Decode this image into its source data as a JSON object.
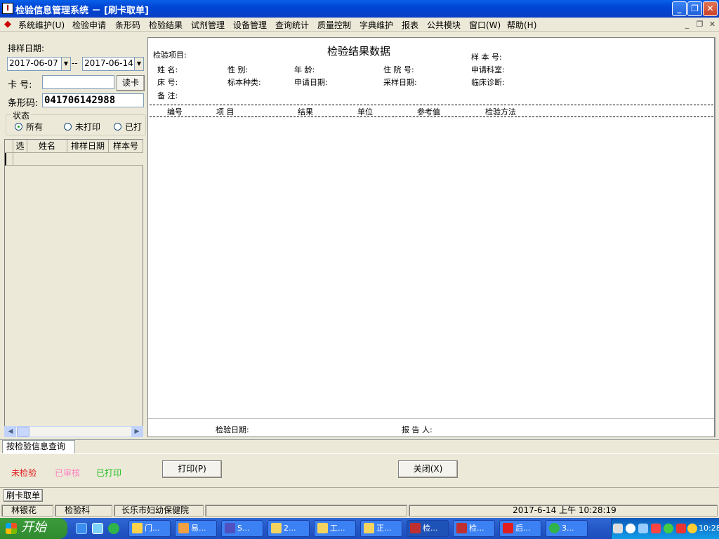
{
  "window": {
    "title": "检验信息管理系统 － [刷卡取单]",
    "controls": {
      "minimize": "_",
      "restore": "❐",
      "close": "✕"
    }
  },
  "menu": [
    "系统维护(U)",
    "检验申请",
    "条形码",
    "检验结果",
    "试剂管理",
    "设备管理",
    "查询统计",
    "质量控制",
    "字典维护",
    "报表",
    "公共模块",
    "窗口(W)",
    "帮助(H)"
  ],
  "left": {
    "date_label": "排样日期:",
    "date_from": "2017-06-07",
    "date_sep": "--",
    "date_to": "2017-06-14",
    "card_label": "卡  号:",
    "card_value": "",
    "read_card_button": "读卡",
    "barcode_label": "条形码:",
    "barcode_value": "041706142988",
    "status_group": "状态",
    "status_options": [
      "所有",
      "未打印",
      "已打"
    ],
    "grid_headers": [
      "选",
      "姓名",
      "排样日期",
      "样本号"
    ]
  },
  "report": {
    "title": "检验结果数据",
    "fields": {
      "item": "检验项目:",
      "sample_no": "样 本 号:",
      "name": "姓    名:",
      "gender": "性    别:",
      "age": "年    龄:",
      "inpatient_no": "住 院 号:",
      "dept": "申请科室:",
      "bed": "床    号:",
      "specimen": "标本种类:",
      "apply_date": "申请日期:",
      "collect_date": "采样日期:",
      "diagnosis": "临床诊断:",
      "remark": "备    注:"
    },
    "columns": [
      "编号",
      "项    目",
      "结果",
      "单位",
      "参考值",
      "检验方法"
    ],
    "footer": {
      "test_date": "检验日期:",
      "reporter": "报 告 人:"
    }
  },
  "bottom": {
    "tab_label": "按检验信息查询",
    "legend": [
      {
        "text": "未检验",
        "color": "#e02020"
      },
      {
        "text": "已审核",
        "color": "#ff80c0"
      },
      {
        "text": "已打印",
        "color": "#20c020"
      }
    ],
    "print_button": "打印(P)",
    "close_button": "关闭(X)",
    "form_tab": "刷卡取单"
  },
  "statusbar": [
    "林银花",
    "检验科",
    "长乐市妇幼保健院",
    "",
    "2017-6-14 上午 10:28:19"
  ],
  "taskbar": {
    "start": "开始",
    "items": [
      "门...",
      "易...",
      "S...",
      "2...",
      "工...",
      "正...",
      "检...",
      "检...",
      "后...",
      "3..."
    ],
    "clock": "10:28"
  }
}
